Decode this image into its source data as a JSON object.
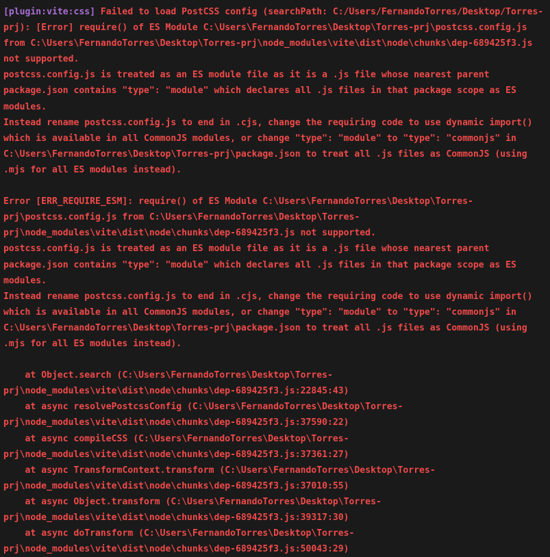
{
  "terminal": {
    "background_color": "#1a1a1a",
    "error_text_color": "#f04a4a",
    "plugin_tag_color": "#a86fd6",
    "plugin_tag": "[plugin:vite:css]",
    "blocks": [
      {
        "id": "primary-error",
        "lines": [
          " Failed to load PostCSS config (searchPath: C:/Users/FernandoTorres/Desktop/Torres-prj): [Error] require() of ES Module C:\\Users\\FernandoTorres\\Desktop\\Torres-prj\\postcss.config.js from C:\\Users\\FernandoTorres\\Desktop\\Torres-prj\\node_modules\\vite\\dist\\node\\chunks\\dep-689425f3.js not supported.",
          "postcss.config.js is treated as an ES module file as it is a .js file whose nearest parent package.json contains \"type\": \"module\" which declares all .js files in that package scope as ES modules.",
          "Instead rename postcss.config.js to end in .cjs, change the requiring code to use dynamic import() which is available in all CommonJS modules, or change \"type\": \"module\" to \"type\": \"commonjs\" in C:\\Users\\FernandoTorres\\Desktop\\Torres-prj\\package.json to treat all .js files as CommonJS (using .mjs for all ES modules instead)."
        ]
      },
      {
        "id": "secondary-error",
        "lines": [
          "Error [ERR_REQUIRE_ESM]: require() of ES Module C:\\Users\\FernandoTorres\\Desktop\\Torres-prj\\postcss.config.js from C:\\Users\\FernandoTorres\\Desktop\\Torres-prj\\node_modules\\vite\\dist\\node\\chunks\\dep-689425f3.js not supported.",
          "postcss.config.js is treated as an ES module file as it is a .js file whose nearest parent package.json contains \"type\": \"module\" which declares all .js files in that package scope as ES modules.",
          "Instead rename postcss.config.js to end in .cjs, change the requiring code to use dynamic import() which is available in all CommonJS modules, or change \"type\": \"module\" to \"type\": \"commonjs\" in C:\\Users\\FernandoTorres\\Desktop\\Torres-prj\\package.json to treat all .js files as CommonJS (using .mjs for all ES modules instead)."
        ]
      },
      {
        "id": "stack-trace",
        "lines": [
          "    at Object.search (C:\\Users\\FernandoTorres\\Desktop\\Torres-prj\\node_modules\\vite\\dist\\node\\chunks\\dep-689425f3.js:22845:43)",
          "    at async resolvePostcssConfig (C:\\Users\\FernandoTorres\\Desktop\\Torres-prj\\node_modules\\vite\\dist\\node\\chunks\\dep-689425f3.js:37590:22)",
          "    at async compileCSS (C:\\Users\\FernandoTorres\\Desktop\\Torres-prj\\node_modules\\vite\\dist\\node\\chunks\\dep-689425f3.js:37361:27)",
          "    at async TransformContext.transform (C:\\Users\\FernandoTorres\\Desktop\\Torres-prj\\node_modules\\vite\\dist\\node\\chunks\\dep-689425f3.js:37010:55)",
          "    at async Object.transform (C:\\Users\\FernandoTorres\\Desktop\\Torres-prj\\node_modules\\vite\\dist\\node\\chunks\\dep-689425f3.js:39317:30)",
          "    at async doTransform (C:\\Users\\FernandoTorres\\Desktop\\Torres-prj\\node_modules\\vite\\dist\\node\\chunks\\dep-689425f3.js:50043:29)"
        ]
      }
    ]
  }
}
